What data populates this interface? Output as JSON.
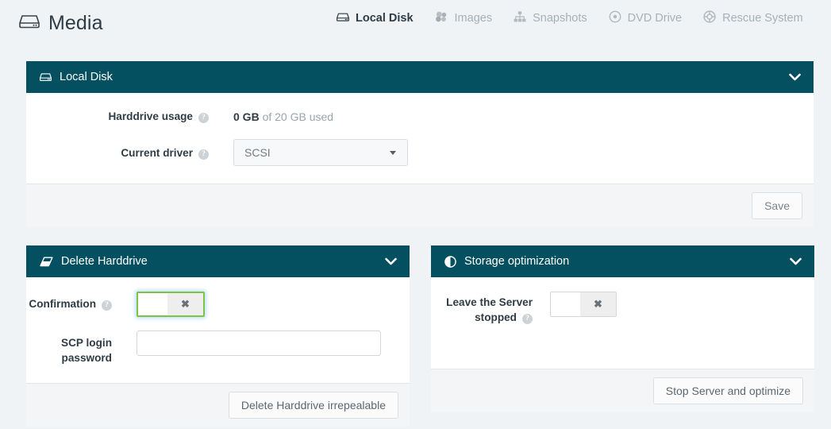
{
  "header": {
    "title": "Media",
    "title_icon": "harddrive-icon",
    "tabs": [
      {
        "label": "Local Disk",
        "icon": "harddrive-icon",
        "active": true
      },
      {
        "label": "Images",
        "icon": "cubes-icon",
        "active": false
      },
      {
        "label": "Snapshots",
        "icon": "sitemap-icon",
        "active": false
      },
      {
        "label": "DVD Drive",
        "icon": "disc-icon",
        "active": false
      },
      {
        "label": "Rescue System",
        "icon": "lifering-icon",
        "active": false
      }
    ]
  },
  "local_disk": {
    "panel_title": "Local Disk",
    "panel_icon": "harddrive-icon",
    "collapse_icon": "chevron-down-icon",
    "usage_label": "Harddrive usage",
    "usage_value_bold": "0 GB",
    "usage_value_rest": "of 20 GB used",
    "driver_label": "Current driver",
    "driver_value": "SCSI",
    "driver_options": [
      "SCSI"
    ],
    "save_label": "Save",
    "help_glyph": "?"
  },
  "delete_harddrive": {
    "panel_title": "Delete Harddrive",
    "panel_icon": "eraser-icon",
    "collapse_icon": "chevron-down-icon",
    "confirmation_label": "Confirmation",
    "confirmation_state_off_glyph": "✖",
    "confirmation_checked": false,
    "password_label": "SCP login password",
    "password_value": "",
    "password_placeholder": "",
    "submit_label": "Delete Harddrive irrepealable",
    "help_glyph": "?"
  },
  "storage_optimization": {
    "panel_title": "Storage optimization",
    "panel_icon": "adjust-icon",
    "collapse_icon": "chevron-down-icon",
    "leave_stopped_label": "Leave the Server stopped",
    "leave_stopped_state_off_glyph": "✖",
    "leave_stopped_checked": false,
    "submit_label": "Stop Server and optimize",
    "help_glyph": "?"
  },
  "colors": {
    "panel_header": "#045060",
    "page_background": "#eff3f6",
    "focus_green": "#80c342",
    "text_dark": "#2f3c45",
    "text_muted": "#9aa4ab"
  }
}
